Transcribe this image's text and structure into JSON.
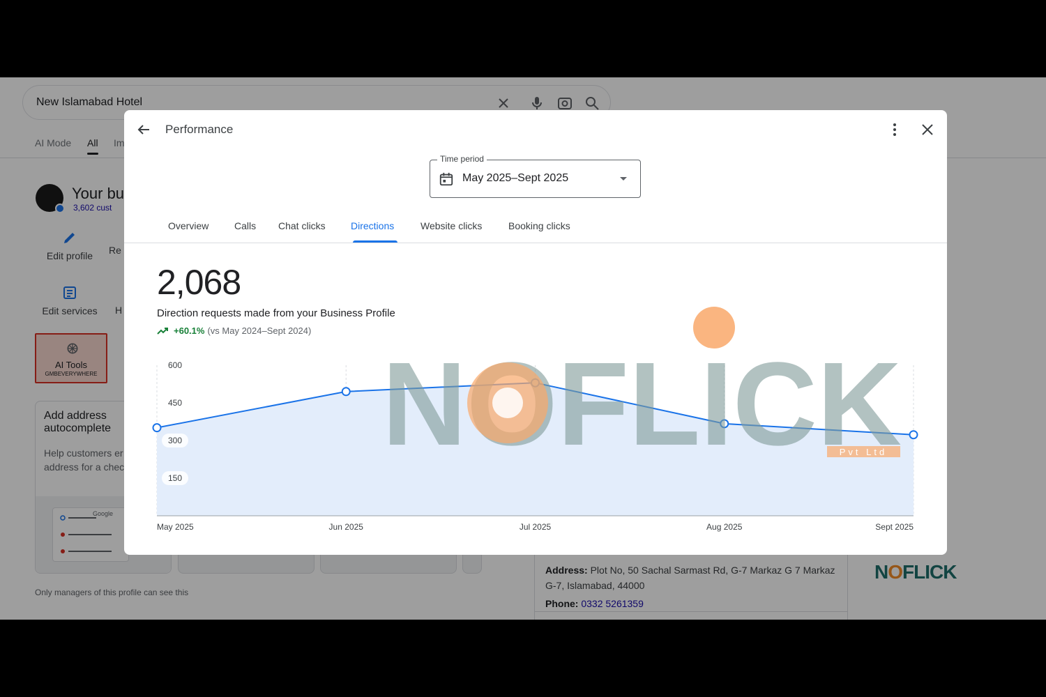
{
  "search": {
    "query": "New Islamabad Hotel"
  },
  "search_tabs": [
    "AI Mode",
    "All",
    "Im"
  ],
  "business": {
    "title": "Your bus",
    "sub": "3,602 cust",
    "actions": [
      "Edit profile",
      "Re",
      "Edit services",
      "H"
    ],
    "ai_tools": {
      "label": "AI Tools",
      "sub": "GMBEVERYWHERE"
    },
    "card": {
      "title": "Add address autocomplete",
      "desc": "Help customers er right address for a checkout",
      "mock_label": "Google"
    },
    "footnote": "Only managers of this profile can see this"
  },
  "info": {
    "address_label": "Address:",
    "address": "Plot No, 50 Sachal Sarmast Rd, G-7 Markaz G 7 Markaz G-7, Islamabad, 44000",
    "phone_label": "Phone:",
    "phone": "0332 5261359"
  },
  "corner_logo": {
    "a": "N",
    "b": "O",
    "c": "FLICK"
  },
  "dialog": {
    "title": "Performance",
    "time_period": {
      "label": "Time period",
      "value": "May 2025–Sept 2025"
    },
    "tabs": [
      "Overview",
      "Calls",
      "Chat clicks",
      "Directions",
      "Website clicks",
      "Booking clicks"
    ],
    "active_tab": "Directions",
    "metric": {
      "value": "2,068",
      "description": "Direction requests made from your Business Profile",
      "change": "+60.1%",
      "compare": "(vs May 2024–Sept 2024)"
    }
  },
  "watermark": {
    "text": "NOFLICK",
    "sub": "Pvt Ltd"
  },
  "chart_data": {
    "type": "area",
    "categories": [
      "May 2025",
      "Jun 2025",
      "Jul 2025",
      "Aug 2025",
      "Sept 2025"
    ],
    "values": [
      351,
      495,
      530,
      367,
      323
    ],
    "yticks": [
      150,
      300,
      450,
      600
    ],
    "ylim": [
      0,
      600
    ],
    "grid": "vertical-dashed",
    "line_color": "#1a73e8",
    "fill_color": "#e3edfb"
  }
}
